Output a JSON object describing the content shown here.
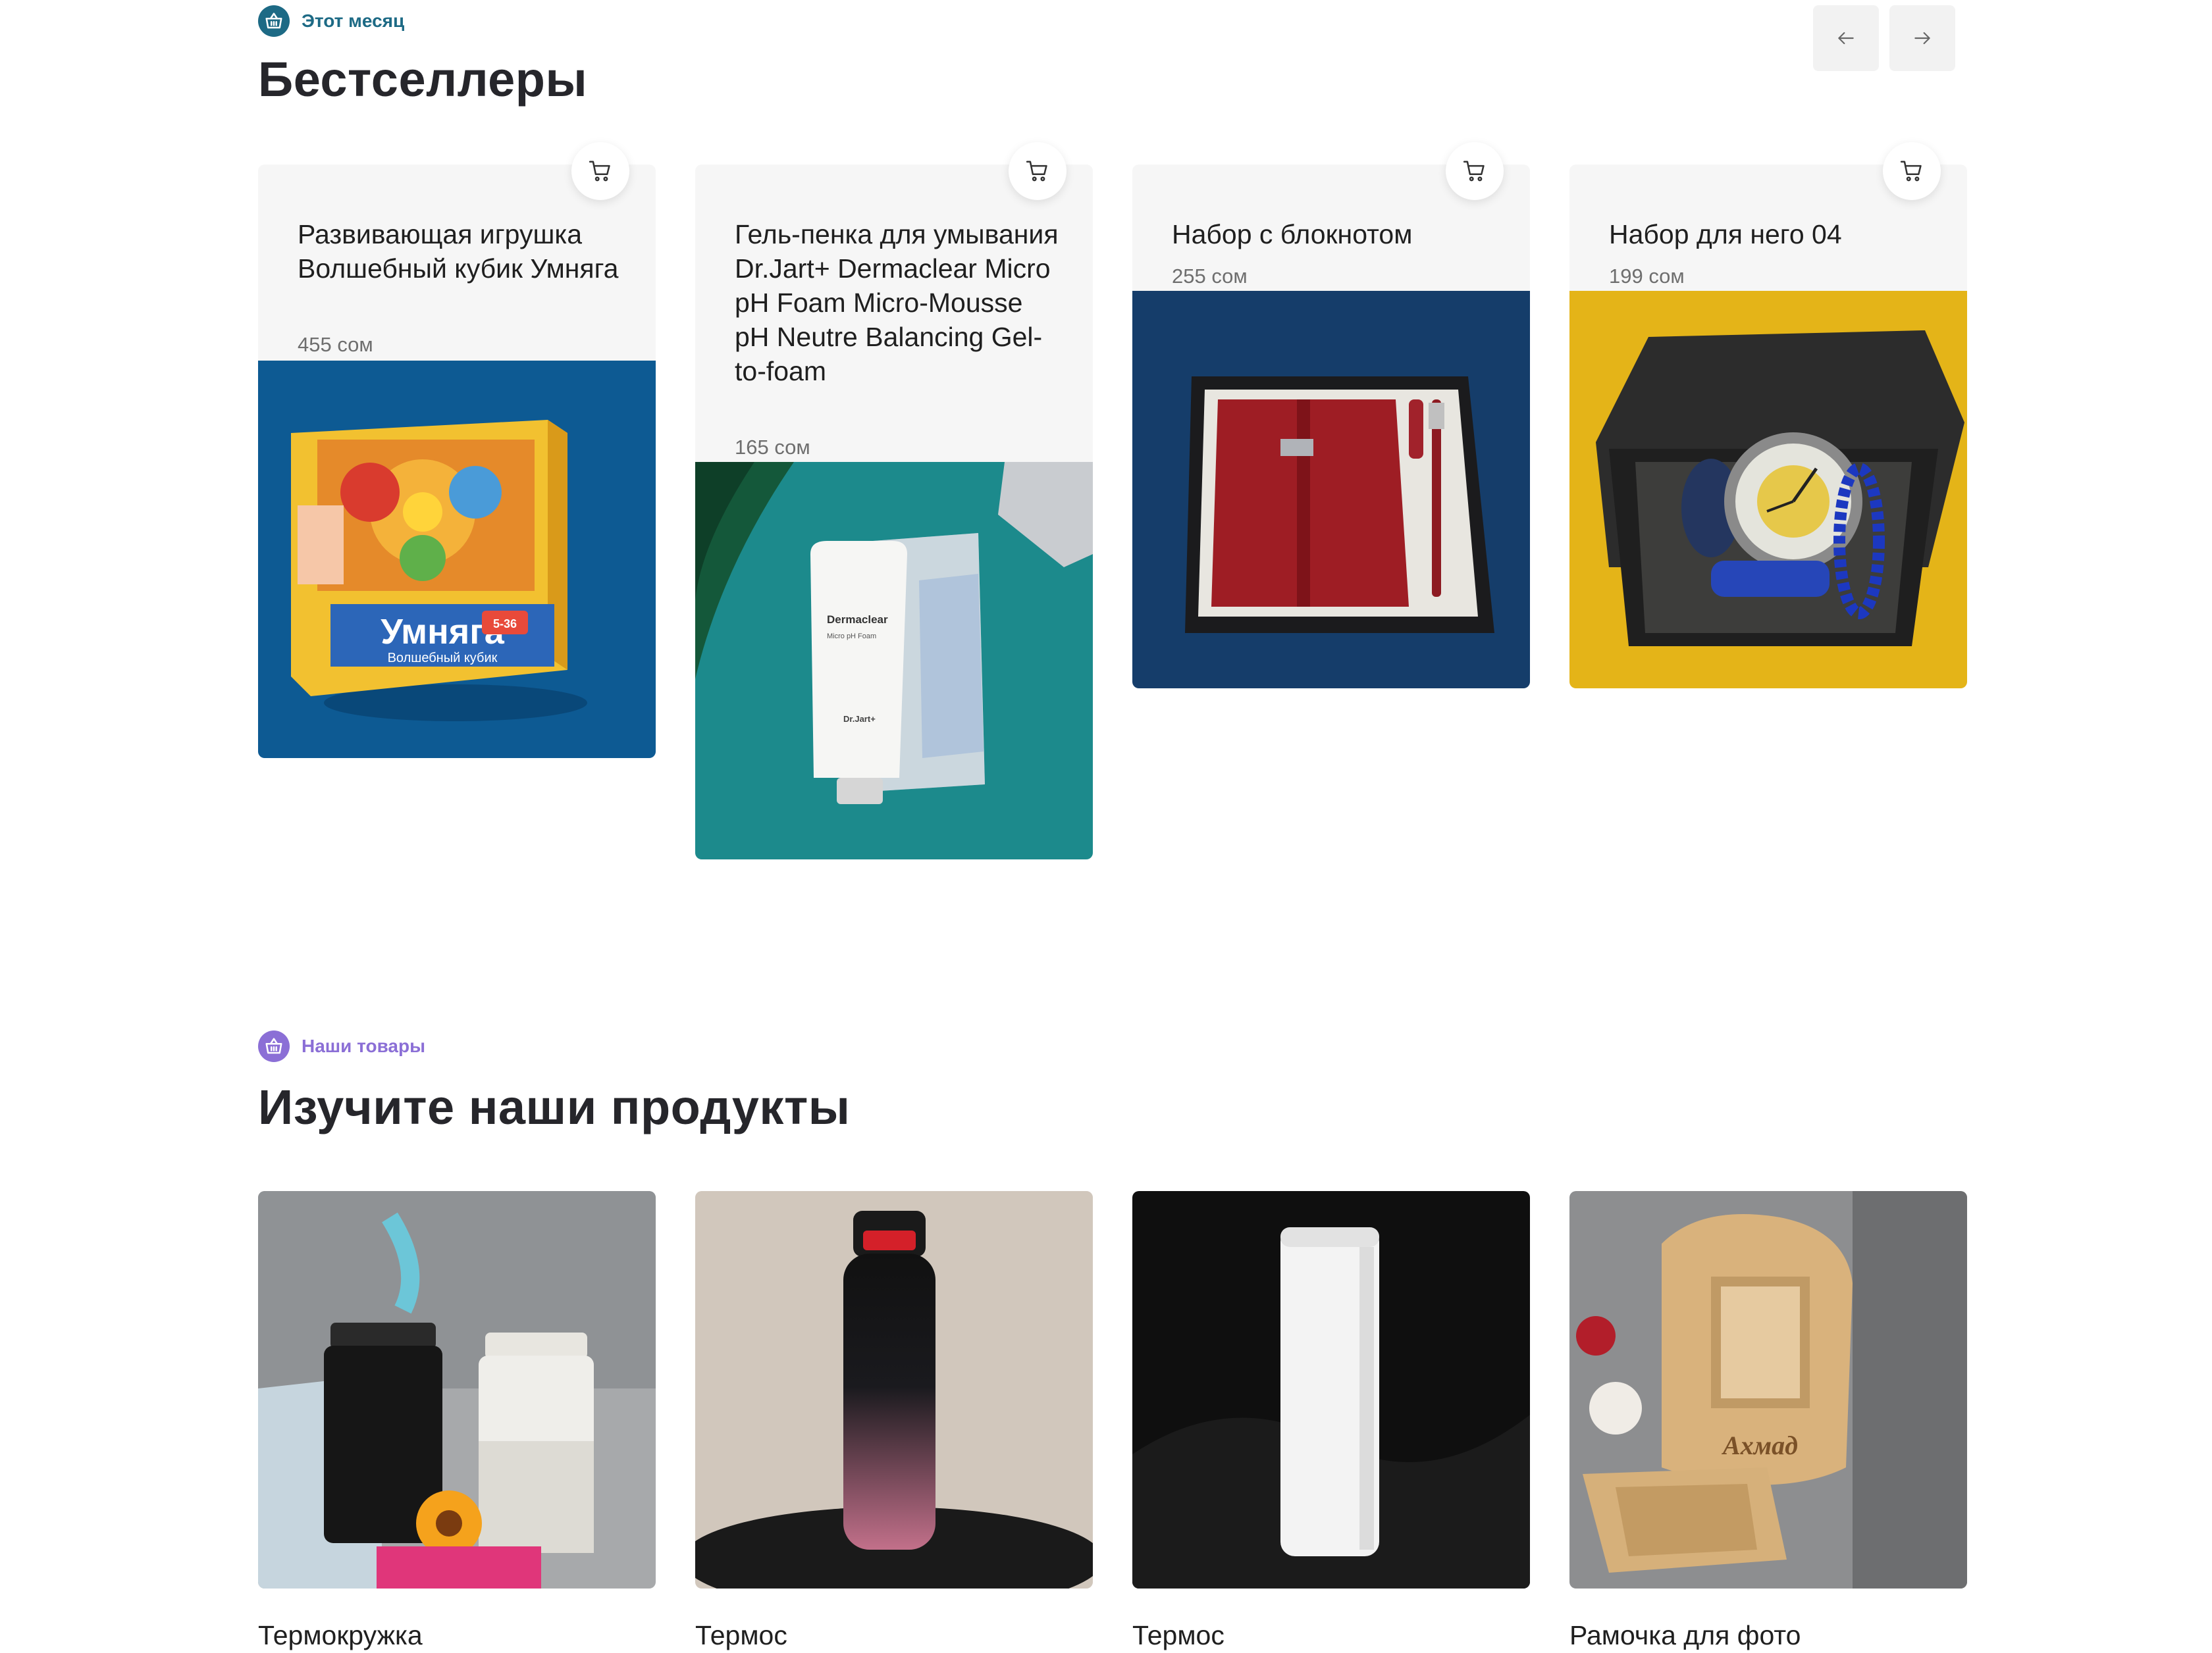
{
  "bestsellers": {
    "eyebrow": "Этот месяц",
    "title": "Бестселлеры",
    "cards": [
      {
        "title": "Развивающая игрушка Волшебный кубик Умняга",
        "price": "455 сом",
        "box_text": "Умняга",
        "box_subtext": "Волшебный кубик",
        "age": "5-36"
      },
      {
        "title": "Гель-пенка для умывания Dr.Jart+ Dermaclear Micro pH Foam Micro-Mousse pH Neutre Balancing Gel-to-foam",
        "price": "165 сом",
        "tube_brand": "Dermaclear",
        "tube_line": "Micro pH Foam",
        "tube_maker": "Dr.Jart+"
      },
      {
        "title": "Набор с блокнотом",
        "price": "255 сом"
      },
      {
        "title": "Набор для него 04",
        "price": "199 сом"
      }
    ]
  },
  "products": {
    "eyebrow": "Наши товары",
    "title": "Изучите наши продукты",
    "items": [
      {
        "name": "Термокружка"
      },
      {
        "name": "Термос"
      },
      {
        "name": "Термос"
      },
      {
        "name": "Рамочка для фото",
        "frame_text": "Ахмад"
      }
    ]
  },
  "icons": {
    "basket": "basket-icon",
    "cart": "cart-icon",
    "prev": "arrow-left-icon",
    "next": "arrow-right-icon"
  },
  "colors": {
    "accent_teal": "#1d6a85",
    "accent_purple": "#8b6fd6",
    "card_bg": "#f6f6f6"
  }
}
